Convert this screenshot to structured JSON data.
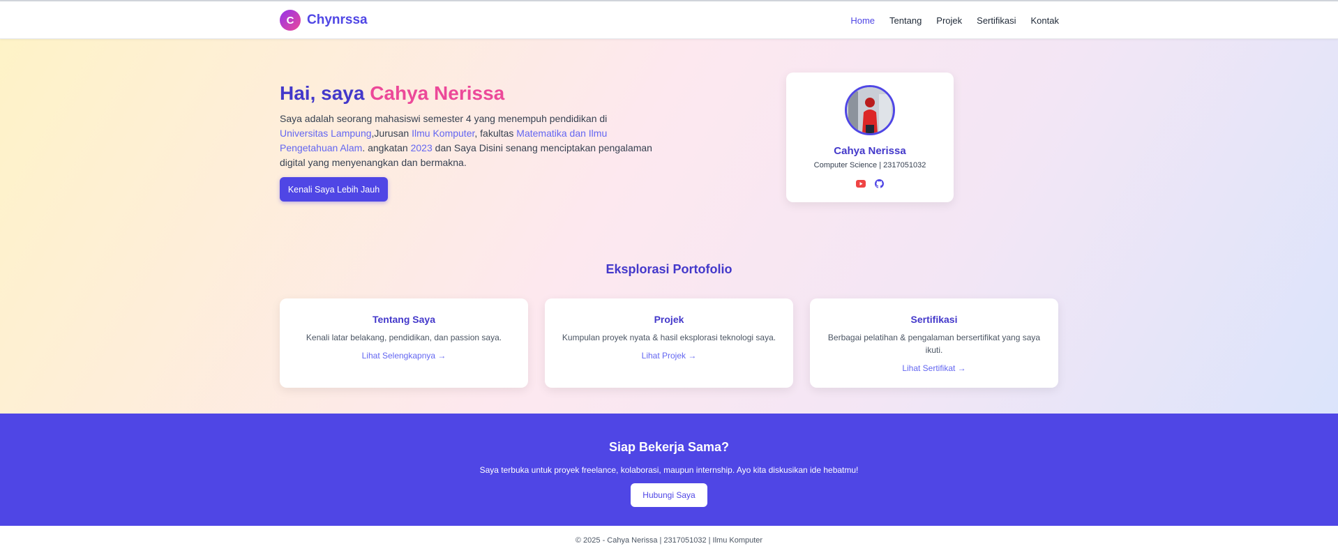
{
  "nav": {
    "logo_letter": "C",
    "brand": "Chynrssa",
    "links": [
      "Home",
      "Tentang",
      "Projek",
      "Sertifikasi",
      "Kontak"
    ]
  },
  "hero": {
    "title_prefix": "Hai, saya ",
    "title_name": "Cahya Nerissa",
    "desc": {
      "p1": "Saya adalah seorang mahasiswi semester 4 yang menempuh pendidikan di ",
      "univ": "Universitas Lampung",
      "p2": ",Jurusan ",
      "major": "Ilmu Komputer",
      "p3": ", fakultas ",
      "faculty": "Matematika dan Ilmu Pengetahuan Alam",
      "p4": ". angkatan ",
      "year": "2023",
      "p5": " dan Saya Disini senang menciptakan pengalaman digital yang menyenangkan dan bermakna."
    },
    "button": "Kenali Saya Lebih Jauh"
  },
  "profile": {
    "name": "Cahya Nerissa",
    "subtitle": "Computer Science | 2317051032",
    "icons": [
      "youtube-icon",
      "github-icon"
    ]
  },
  "explore": {
    "title": "Eksplorasi Portofolio",
    "cards": [
      {
        "title": "Tentang Saya",
        "desc": "Kenali latar belakang, pendidikan, dan passion saya.",
        "link": "Lihat Selengkapnya →"
      },
      {
        "title": "Projek",
        "desc": "Kumpulan proyek nyata & hasil eksplorasi teknologi saya.",
        "link": "Lihat Projek →"
      },
      {
        "title": "Sertifikasi",
        "desc": "Berbagai pelatihan & pengalaman bersertifikat yang saya ikuti.",
        "link": "Lihat Sertifikat →"
      }
    ]
  },
  "cta": {
    "title": "Siap Bekerja Sama?",
    "text": "Saya terbuka untuk proyek freelance, kolaborasi, maupun internship. Ayo kita diskusikan ide hebatmu!",
    "button": "Hubungi Saya"
  },
  "footer": {
    "text": "© 2025 - Cahya Nerissa | 2317051032 | Ilmu Komputer"
  },
  "colors": {
    "primary": "#4f46e5",
    "accent_pink": "#ec4899",
    "youtube": "#ef4444"
  }
}
